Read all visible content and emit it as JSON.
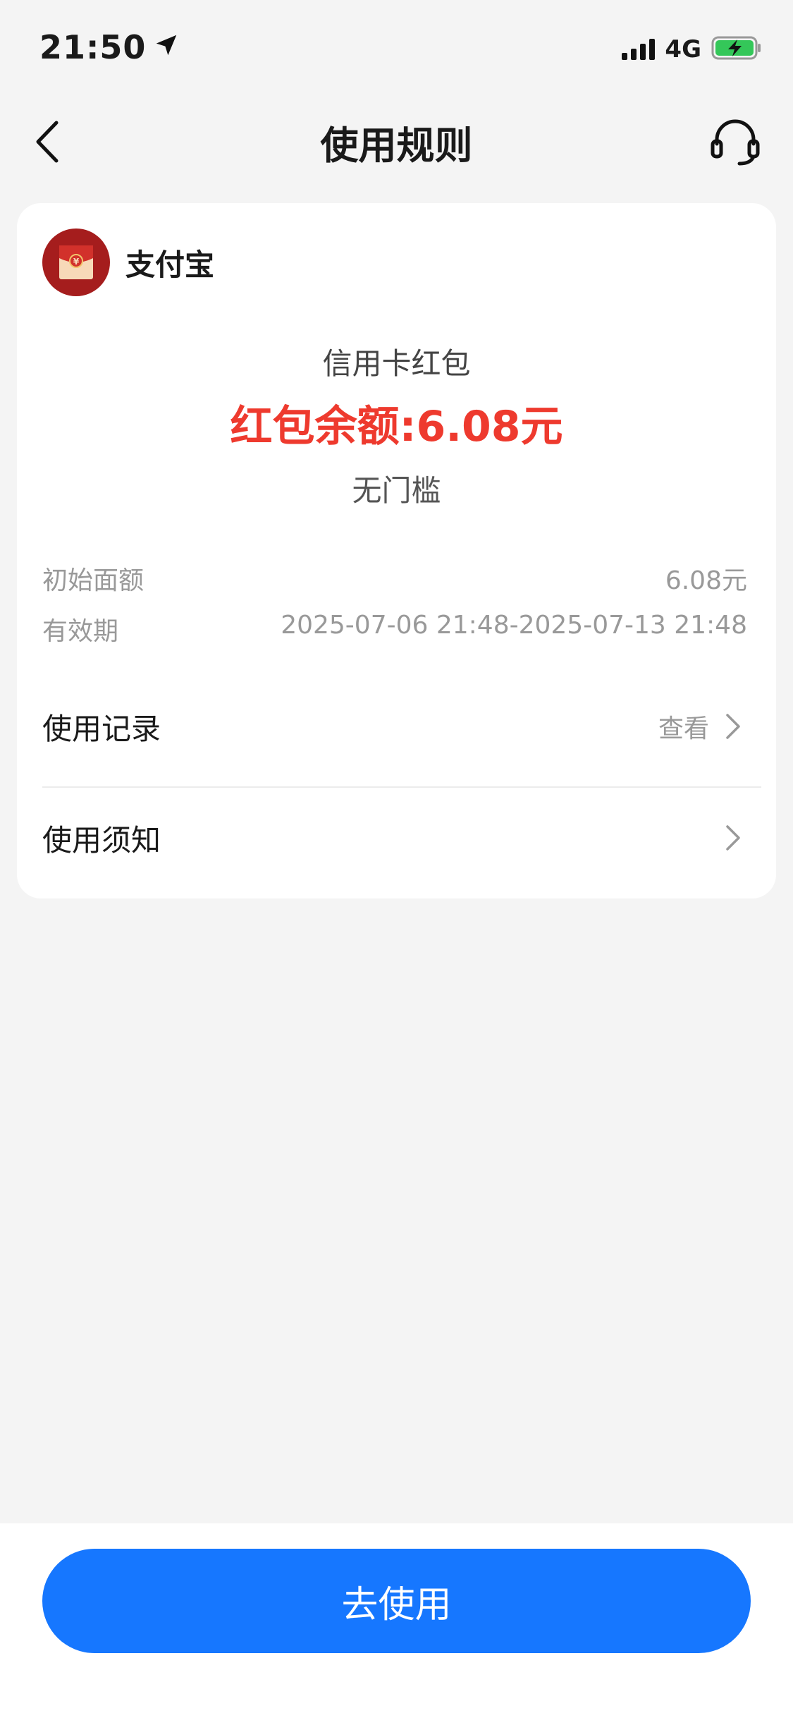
{
  "status_bar": {
    "time": "21:50",
    "network": "4G"
  },
  "nav": {
    "title": "使用规则"
  },
  "brand": {
    "name": "支付宝"
  },
  "coupon": {
    "name": "信用卡红包",
    "balance_text": "红包余额:6.08元",
    "threshold": "无门槛"
  },
  "details": {
    "initial_label": "初始面额",
    "initial_value": "6.08元",
    "valid_label": "有效期",
    "valid_value": "2025-07-06 21:48-2025-07-13 21:48"
  },
  "links": {
    "record_label": "使用记录",
    "record_action": "查看",
    "notice_label": "使用须知"
  },
  "actions": {
    "use_label": "去使用"
  },
  "colors": {
    "accent": "#1677ff",
    "balance": "#ee3a2e",
    "battery": "#34c759"
  }
}
